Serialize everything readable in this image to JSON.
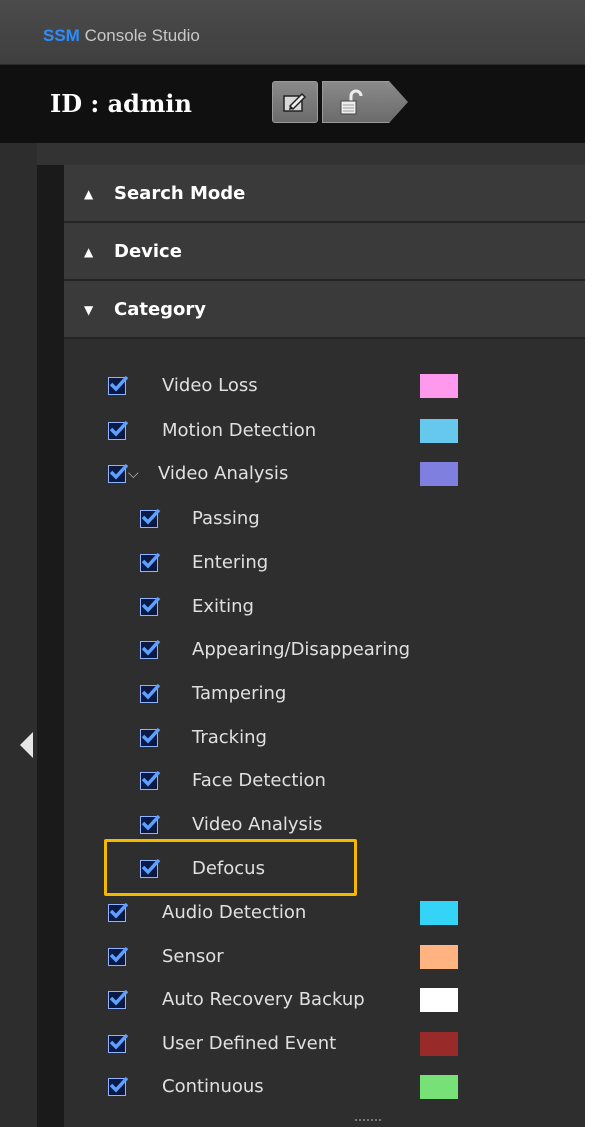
{
  "app": {
    "brand": "SSM",
    "title_rest": " Console Studio"
  },
  "idbar": {
    "id_text": "ID : admin"
  },
  "sections": [
    {
      "label": "Search Mode",
      "expanded": false
    },
    {
      "label": "Device",
      "expanded": false
    },
    {
      "label": "Category",
      "expanded": true
    }
  ],
  "icons": {
    "expand": "▼",
    "collapse": "▲",
    "sub_chevron": "⌵"
  },
  "categories": [
    {
      "label": "Video Loss",
      "checked": true,
      "color": "#ff99ee"
    },
    {
      "label": "Motion Detection",
      "checked": true,
      "color": "#66c8ec"
    },
    {
      "label": "Video Analysis",
      "checked": true,
      "color": "#7f7fe0",
      "expanded": true,
      "children": [
        {
          "label": "Passing",
          "checked": true
        },
        {
          "label": "Entering",
          "checked": true
        },
        {
          "label": "Exiting",
          "checked": true
        },
        {
          "label": "Appearing/Disappearing",
          "checked": true
        },
        {
          "label": "Tampering",
          "checked": true
        },
        {
          "label": "Tracking",
          "checked": true
        },
        {
          "label": "Face Detection",
          "checked": true
        },
        {
          "label": "Video Analysis",
          "checked": true
        },
        {
          "label": "Defocus",
          "checked": true,
          "highlighted": true
        }
      ]
    },
    {
      "label": "Audio Detection",
      "checked": true,
      "color": "#33d4f5"
    },
    {
      "label": "Sensor",
      "checked": true,
      "color": "#ffb380"
    },
    {
      "label": "Auto Recovery Backup",
      "checked": true,
      "color": "#ffffff"
    },
    {
      "label": "User Defined Event",
      "checked": true,
      "color": "#992a2a"
    },
    {
      "label": "Continuous",
      "checked": true,
      "color": "#77e077"
    }
  ],
  "colors": {
    "highlight": "#f5b800",
    "brand": "#2d8cff"
  }
}
